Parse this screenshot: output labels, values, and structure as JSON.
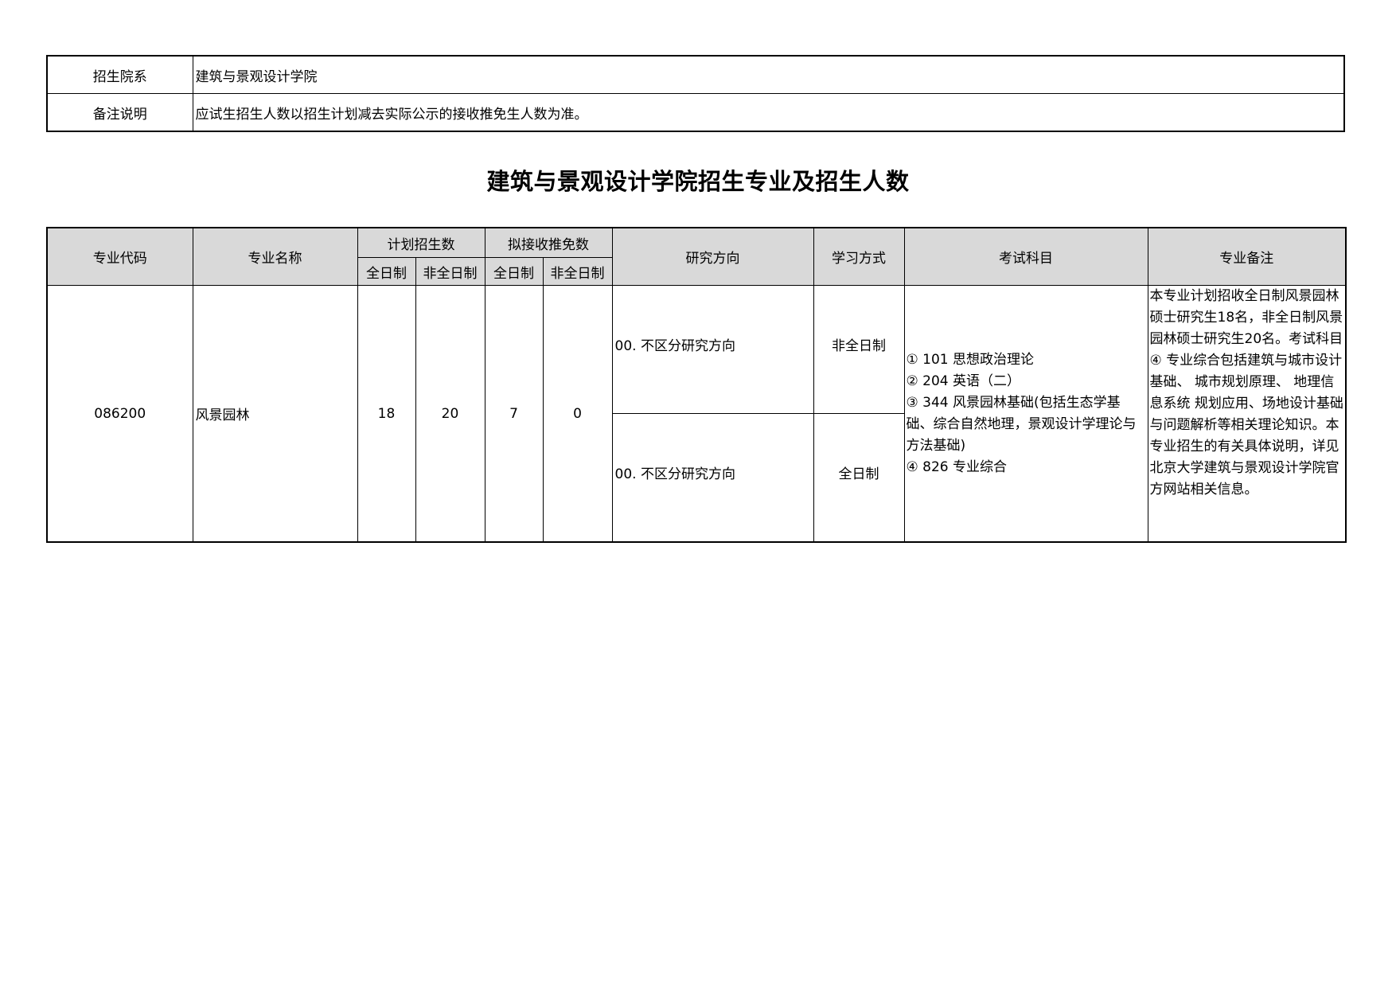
{
  "info": {
    "dept_label": "招生院系",
    "dept_value": "建筑与景观设计学院",
    "note_label": "备注说明",
    "note_value": "应试生招生人数以招生计划减去实际公示的接收推免生人数为准。"
  },
  "title": "建筑与景观设计学院招生专业及招生人数",
  "table": {
    "headers": {
      "code": "专业代码",
      "name": "专业名称",
      "plan": "计划招生数",
      "exempt": "拟接收推免数",
      "direction": "研究方向",
      "mode": "学习方式",
      "subjects": "考试科目",
      "remarks": "专业备注",
      "fulltime": "全日制",
      "parttime": "非全日制"
    },
    "row": {
      "code": "086200",
      "name": "风景园林",
      "plan_fulltime": "18",
      "plan_parttime": "20",
      "exempt_fulltime": "7",
      "exempt_parttime": "0",
      "directions": [
        {
          "direction": "00. 不区分研究方向",
          "mode": "非全日制"
        },
        {
          "direction": "00. 不区分研究方向",
          "mode": "全日制"
        }
      ],
      "subjects": [
        "① 101 思想政治理论",
        "② 204 英语（二）",
        "③ 344 风景园林基础(包括生态学基础、综合自然地理，景观设计学理论与方法基础)",
        "④ 826 专业综合"
      ],
      "remarks": "本专业计划招收全日制风景园林硕士研究生18名，非全日制风景园林硕士研究生20名。考试科目④ 专业综合包括建筑与城市设计基础、 城市规划原理、 地理信息系统 规划应用、场地设计基础与问题解析等相关理论知识。本专业招生的有关具体说明，详见北京大学建筑与景观设计学院官方网站相关信息。"
    }
  }
}
